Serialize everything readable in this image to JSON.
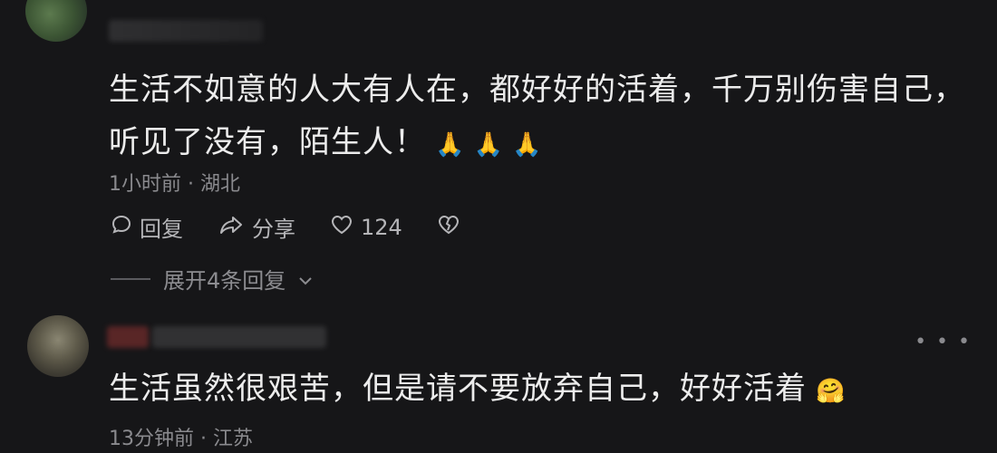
{
  "comments": [
    {
      "text": "生活不如意的人大有人在，都好好的活着，千万别伤害自己，听见了没有，陌生人！",
      "emoji": "🙏 🙏 🙏",
      "meta": "1小时前 · 湖北",
      "actions": {
        "reply": "回复",
        "share": "分享",
        "likes": "124"
      },
      "expand_label": "展开4条回复"
    },
    {
      "text": "生活虽然很艰苦，但是请不要放弃自己，好好活着",
      "emoji": "🤗",
      "meta": "13分钟前 · 江苏"
    }
  ],
  "icons": {
    "reply": "comment-bubble-icon",
    "share": "share-arrow-icon",
    "like": "heart-icon",
    "dislike": "broken-heart-icon",
    "expand": "chevron-down-icon",
    "more": "more-dots-icon"
  }
}
